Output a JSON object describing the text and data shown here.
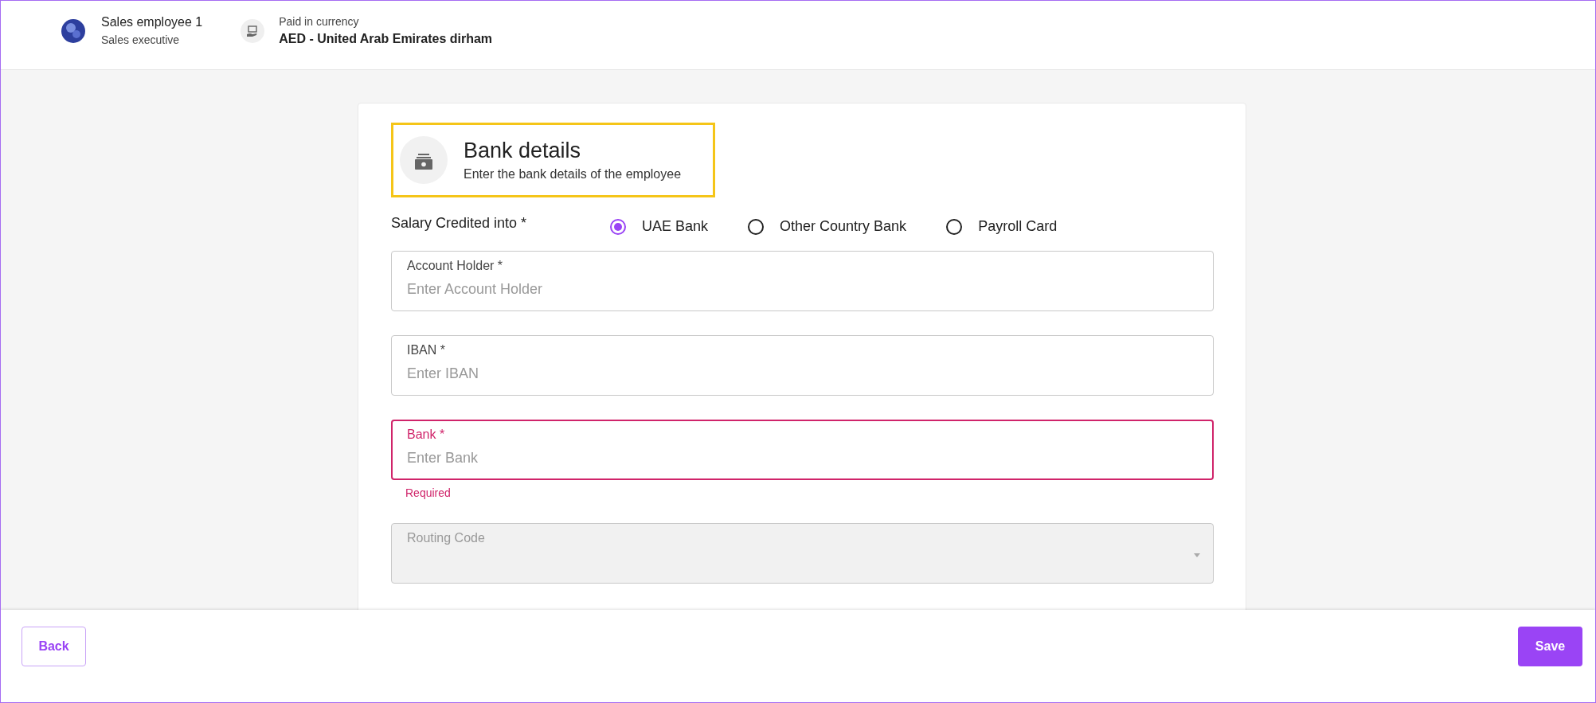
{
  "header": {
    "employee": {
      "name": "Sales employee 1",
      "role": "Sales executive"
    },
    "currency": {
      "label": "Paid in currency",
      "value": "AED - United Arab Emirates dirham"
    }
  },
  "section": {
    "title": "Bank details",
    "subtitle": "Enter the bank details of the employee",
    "highlighted": true
  },
  "salary_credited": {
    "label": "Salary Credited into *",
    "options": [
      {
        "label": "UAE Bank",
        "selected": true
      },
      {
        "label": "Other Country Bank",
        "selected": false
      },
      {
        "label": "Payroll Card",
        "selected": false
      }
    ]
  },
  "fields": [
    {
      "kind": "text",
      "label": "Account Holder *",
      "placeholder": "Enter Account Holder",
      "error": false,
      "disabled": false
    },
    {
      "kind": "text",
      "label": "IBAN *",
      "placeholder": "Enter IBAN",
      "error": false,
      "disabled": false
    },
    {
      "kind": "text",
      "label": "Bank *",
      "placeholder": "Enter Bank",
      "error": true,
      "error_text": "Required",
      "disabled": false
    },
    {
      "kind": "select",
      "label": "Routing Code",
      "error": false,
      "disabled": true
    }
  ],
  "footer": {
    "back": "Back",
    "save": "Save"
  }
}
